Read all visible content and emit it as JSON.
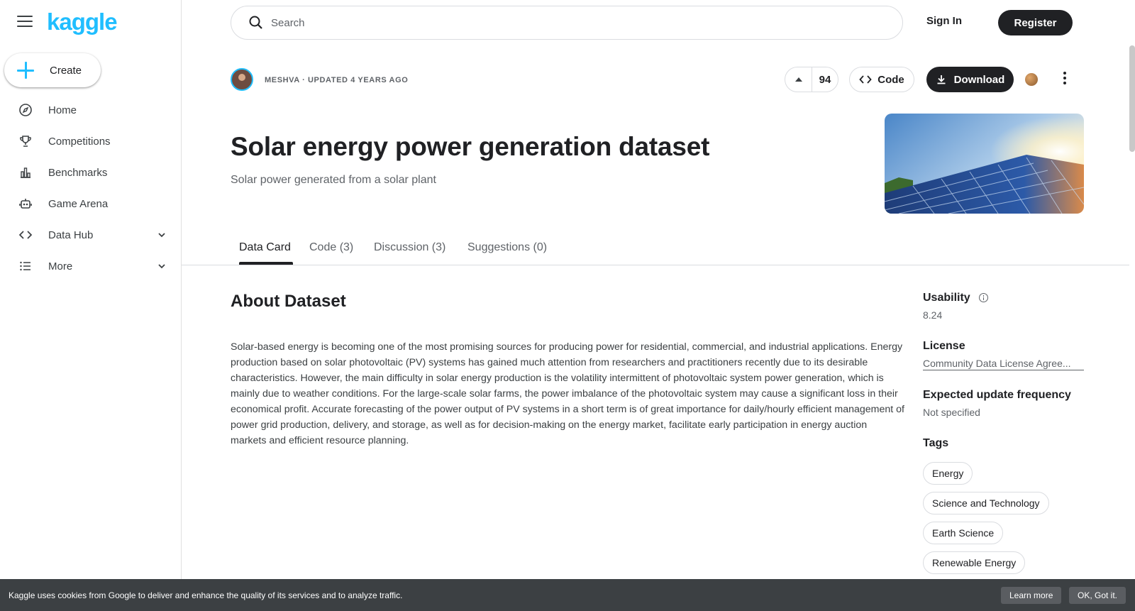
{
  "sidebar": {
    "logo": "kaggle",
    "create_label": "Create",
    "items": [
      {
        "label": "Home",
        "icon": "compass-icon"
      },
      {
        "label": "Competitions",
        "icon": "trophy-icon"
      },
      {
        "label": "Benchmarks",
        "icon": "bar-chart-icon"
      },
      {
        "label": "Game Arena",
        "icon": "robot-icon"
      },
      {
        "label": "Data Hub",
        "icon": "code-brackets-icon"
      },
      {
        "label": "More",
        "icon": "list-icon"
      }
    ]
  },
  "topbar": {
    "search_placeholder": "Search",
    "signin_label": "Sign In",
    "register_label": "Register"
  },
  "dataset": {
    "meta": "MESHVA · UPDATED 4 YEARS AGO",
    "votes": "94",
    "code_label": "Code",
    "download_label": "Download",
    "title": "Solar energy power generation dataset",
    "subtitle": "Solar power generated from a solar plant"
  },
  "tabs": [
    {
      "label": "Data Card",
      "active": true
    },
    {
      "label": "Code (3)",
      "active": false
    },
    {
      "label": "Discussion (3)",
      "active": false
    },
    {
      "label": "Suggestions (0)",
      "active": false
    }
  ],
  "about": {
    "heading": "About Dataset",
    "text": "Solar-based energy is becoming one of the most promising sources for producing power for residential, commercial, and industrial applications. Energy production based on solar photovoltaic (PV) systems has gained much attention from researchers and practitioners recently due to its desirable characteristics. However, the main difficulty in solar energy production is the volatility intermittent of photovoltaic system power generation, which is mainly due to weather conditions. For the large-scale solar farms, the power imbalance of the photovoltaic system may cause a significant loss in their economical profit. Accurate forecasting of the power output of PV systems in a short term is of great importance for daily/hourly efficient management of power grid production, delivery, and storage, as well as for decision-making on the energy market, facilitate early participation in energy auction markets and efficient resource planning."
  },
  "details": {
    "usability_label": "Usability",
    "usability_value": "8.24",
    "license_label": "License",
    "license_value": "Community Data License Agree...",
    "frequency_label": "Expected update frequency",
    "frequency_value": "Not specified",
    "tags_label": "Tags",
    "tags": [
      "Energy",
      "Science and Technology",
      "Earth Science",
      "Renewable Energy"
    ]
  },
  "cookie": {
    "text": "Kaggle uses cookies from Google to deliver and enhance the quality of its services and to analyze traffic.",
    "learn_more": "Learn more",
    "ok": "OK, Got it."
  },
  "colors": {
    "accent": "#20beff",
    "dark": "#202124",
    "cookie_bg": "#3c4043"
  }
}
